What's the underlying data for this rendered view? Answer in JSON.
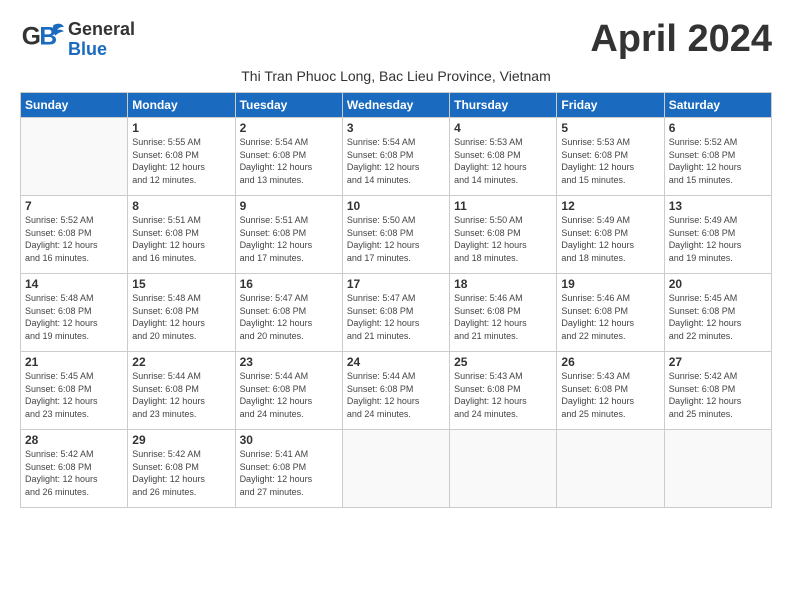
{
  "header": {
    "logo_general": "General",
    "logo_blue": "Blue",
    "month_title": "April 2024",
    "subtitle": "Thi Tran Phuoc Long, Bac Lieu Province, Vietnam"
  },
  "days_of_week": [
    "Sunday",
    "Monday",
    "Tuesday",
    "Wednesday",
    "Thursday",
    "Friday",
    "Saturday"
  ],
  "weeks": [
    [
      {
        "day": "",
        "info": ""
      },
      {
        "day": "1",
        "info": "Sunrise: 5:55 AM\nSunset: 6:08 PM\nDaylight: 12 hours\nand 12 minutes."
      },
      {
        "day": "2",
        "info": "Sunrise: 5:54 AM\nSunset: 6:08 PM\nDaylight: 12 hours\nand 13 minutes."
      },
      {
        "day": "3",
        "info": "Sunrise: 5:54 AM\nSunset: 6:08 PM\nDaylight: 12 hours\nand 14 minutes."
      },
      {
        "day": "4",
        "info": "Sunrise: 5:53 AM\nSunset: 6:08 PM\nDaylight: 12 hours\nand 14 minutes."
      },
      {
        "day": "5",
        "info": "Sunrise: 5:53 AM\nSunset: 6:08 PM\nDaylight: 12 hours\nand 15 minutes."
      },
      {
        "day": "6",
        "info": "Sunrise: 5:52 AM\nSunset: 6:08 PM\nDaylight: 12 hours\nand 15 minutes."
      }
    ],
    [
      {
        "day": "7",
        "info": "Sunrise: 5:52 AM\nSunset: 6:08 PM\nDaylight: 12 hours\nand 16 minutes."
      },
      {
        "day": "8",
        "info": "Sunrise: 5:51 AM\nSunset: 6:08 PM\nDaylight: 12 hours\nand 16 minutes."
      },
      {
        "day": "9",
        "info": "Sunrise: 5:51 AM\nSunset: 6:08 PM\nDaylight: 12 hours\nand 17 minutes."
      },
      {
        "day": "10",
        "info": "Sunrise: 5:50 AM\nSunset: 6:08 PM\nDaylight: 12 hours\nand 17 minutes."
      },
      {
        "day": "11",
        "info": "Sunrise: 5:50 AM\nSunset: 6:08 PM\nDaylight: 12 hours\nand 18 minutes."
      },
      {
        "day": "12",
        "info": "Sunrise: 5:49 AM\nSunset: 6:08 PM\nDaylight: 12 hours\nand 18 minutes."
      },
      {
        "day": "13",
        "info": "Sunrise: 5:49 AM\nSunset: 6:08 PM\nDaylight: 12 hours\nand 19 minutes."
      }
    ],
    [
      {
        "day": "14",
        "info": "Sunrise: 5:48 AM\nSunset: 6:08 PM\nDaylight: 12 hours\nand 19 minutes."
      },
      {
        "day": "15",
        "info": "Sunrise: 5:48 AM\nSunset: 6:08 PM\nDaylight: 12 hours\nand 20 minutes."
      },
      {
        "day": "16",
        "info": "Sunrise: 5:47 AM\nSunset: 6:08 PM\nDaylight: 12 hours\nand 20 minutes."
      },
      {
        "day": "17",
        "info": "Sunrise: 5:47 AM\nSunset: 6:08 PM\nDaylight: 12 hours\nand 21 minutes."
      },
      {
        "day": "18",
        "info": "Sunrise: 5:46 AM\nSunset: 6:08 PM\nDaylight: 12 hours\nand 21 minutes."
      },
      {
        "day": "19",
        "info": "Sunrise: 5:46 AM\nSunset: 6:08 PM\nDaylight: 12 hours\nand 22 minutes."
      },
      {
        "day": "20",
        "info": "Sunrise: 5:45 AM\nSunset: 6:08 PM\nDaylight: 12 hours\nand 22 minutes."
      }
    ],
    [
      {
        "day": "21",
        "info": "Sunrise: 5:45 AM\nSunset: 6:08 PM\nDaylight: 12 hours\nand 23 minutes."
      },
      {
        "day": "22",
        "info": "Sunrise: 5:44 AM\nSunset: 6:08 PM\nDaylight: 12 hours\nand 23 minutes."
      },
      {
        "day": "23",
        "info": "Sunrise: 5:44 AM\nSunset: 6:08 PM\nDaylight: 12 hours\nand 24 minutes."
      },
      {
        "day": "24",
        "info": "Sunrise: 5:44 AM\nSunset: 6:08 PM\nDaylight: 12 hours\nand 24 minutes."
      },
      {
        "day": "25",
        "info": "Sunrise: 5:43 AM\nSunset: 6:08 PM\nDaylight: 12 hours\nand 24 minutes."
      },
      {
        "day": "26",
        "info": "Sunrise: 5:43 AM\nSunset: 6:08 PM\nDaylight: 12 hours\nand 25 minutes."
      },
      {
        "day": "27",
        "info": "Sunrise: 5:42 AM\nSunset: 6:08 PM\nDaylight: 12 hours\nand 25 minutes."
      }
    ],
    [
      {
        "day": "28",
        "info": "Sunrise: 5:42 AM\nSunset: 6:08 PM\nDaylight: 12 hours\nand 26 minutes."
      },
      {
        "day": "29",
        "info": "Sunrise: 5:42 AM\nSunset: 6:08 PM\nDaylight: 12 hours\nand 26 minutes."
      },
      {
        "day": "30",
        "info": "Sunrise: 5:41 AM\nSunset: 6:08 PM\nDaylight: 12 hours\nand 27 minutes."
      },
      {
        "day": "",
        "info": ""
      },
      {
        "day": "",
        "info": ""
      },
      {
        "day": "",
        "info": ""
      },
      {
        "day": "",
        "info": ""
      }
    ]
  ]
}
